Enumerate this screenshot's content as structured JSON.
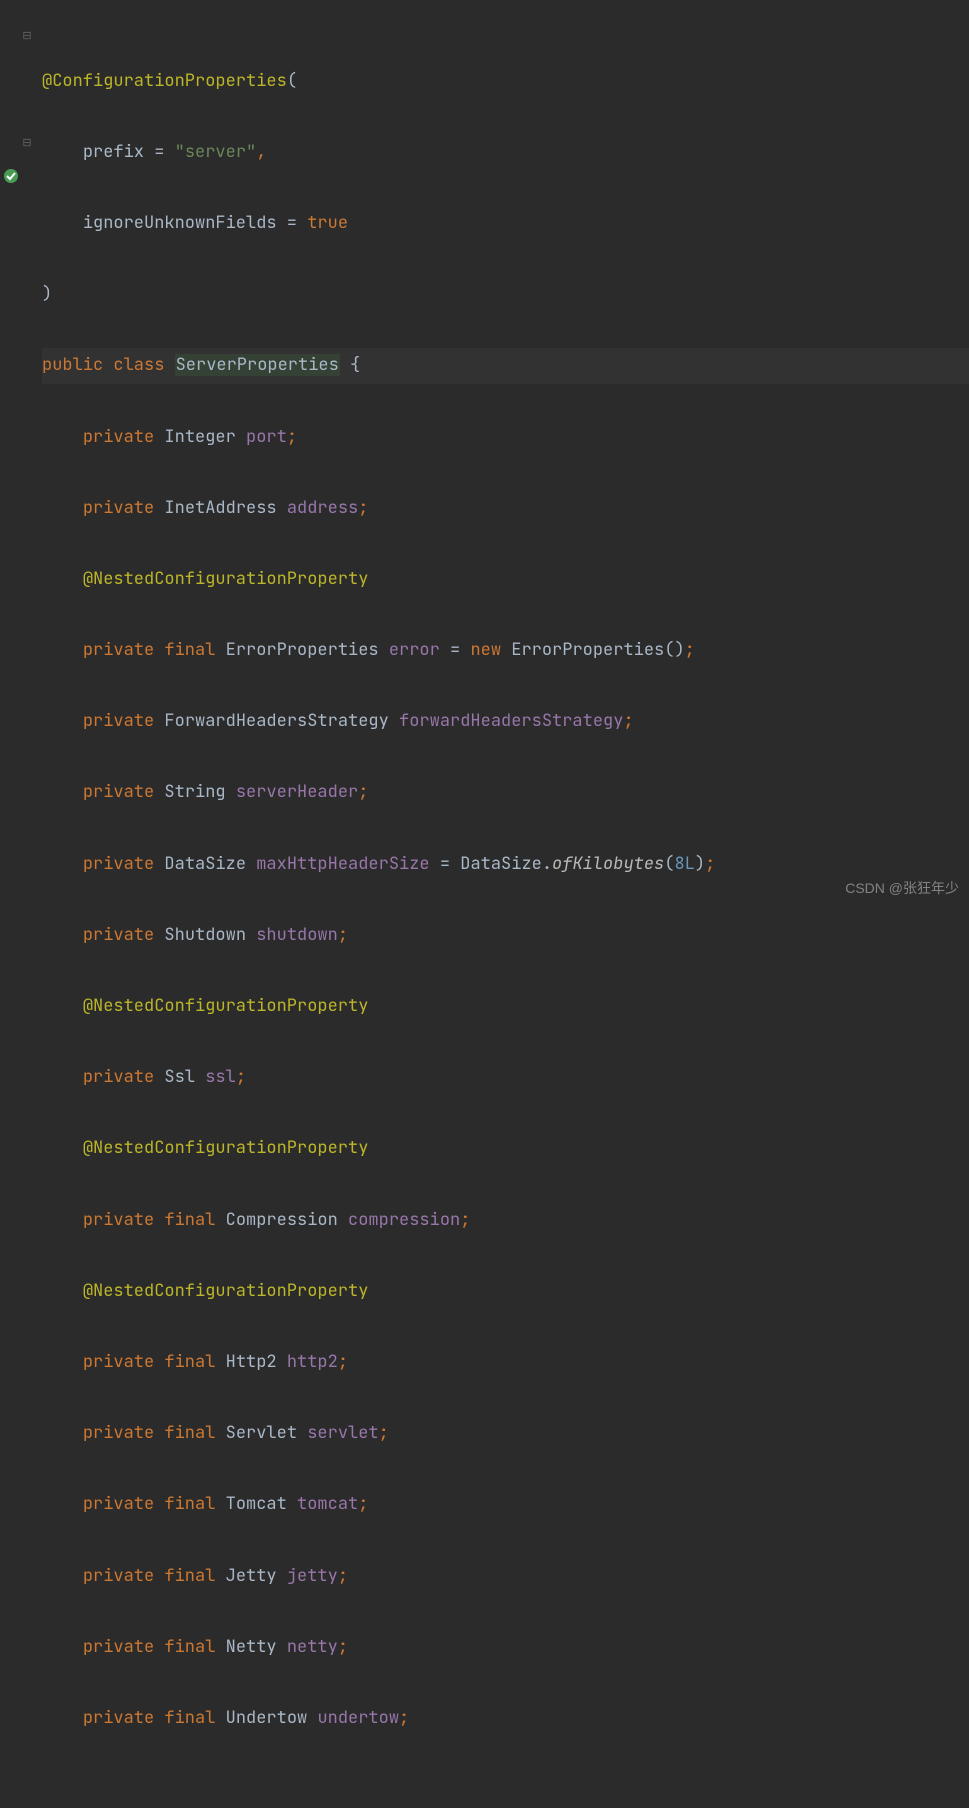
{
  "code": {
    "l1": {
      "anno": "@ConfigurationProperties",
      "paren": "("
    },
    "l2": {
      "t1": "prefix = ",
      "str": "\"server\"",
      "comma": ","
    },
    "l3": {
      "t1": "ignoreUnknownFields = ",
      "kw": "true"
    },
    "l4": {
      "paren": ")"
    },
    "l5": {
      "kw1": "public class ",
      "cls": "ServerProperties",
      "brace": " {"
    },
    "l6": {
      "kw": "private ",
      "type": "Integer ",
      "mem": "port",
      "semi": ";"
    },
    "l7": {
      "kw": "private ",
      "type": "InetAddress ",
      "mem": "address",
      "semi": ";"
    },
    "l8": {
      "anno": "@NestedConfigurationProperty"
    },
    "l9": {
      "kw1": "private final ",
      "type": "ErrorProperties ",
      "mem": "error",
      "eq": " = ",
      "kw2": "new ",
      "ctor": "ErrorProperties()",
      "semi": ";"
    },
    "l10": {
      "kw": "private ",
      "type": "ForwardHeadersStrategy ",
      "mem": "forwardHeadersStrategy",
      "semi": ";"
    },
    "l11": {
      "kw": "private ",
      "type": "String ",
      "mem": "serverHeader",
      "semi": ";"
    },
    "l12": {
      "kw": "private ",
      "type": "DataSize ",
      "mem": "maxHttpHeaderSize",
      "eq": " = DataSize.",
      "stat": "ofKilobytes",
      "po": "(",
      "num": "8L",
      "pc": ")",
      "semi": ";"
    },
    "l13": {
      "kw": "private ",
      "type": "Shutdown ",
      "mem": "shutdown",
      "semi": ";"
    },
    "l14": {
      "anno": "@NestedConfigurationProperty"
    },
    "l15": {
      "kw": "private ",
      "type": "Ssl ",
      "mem": "ssl",
      "semi": ";"
    },
    "l16": {
      "anno": "@NestedConfigurationProperty"
    },
    "l17": {
      "kw1": "private final ",
      "type": "Compression ",
      "mem": "compression",
      "semi": ";"
    },
    "l18": {
      "anno": "@NestedConfigurationProperty"
    },
    "l19": {
      "kw1": "private final ",
      "type": "Http2 ",
      "mem": "http2",
      "semi": ";"
    },
    "l20": {
      "kw1": "private final ",
      "type": "Servlet ",
      "mem": "servlet",
      "semi": ";"
    },
    "l21": {
      "kw1": "private final ",
      "type": "Tomcat ",
      "mem": "tomcat",
      "semi": ";"
    },
    "l22": {
      "kw1": "private final ",
      "type": "Jetty ",
      "mem": "jetty",
      "semi": ";"
    },
    "l23": {
      "kw1": "private final ",
      "type": "Netty ",
      "mem": "netty",
      "semi": ";"
    },
    "l24": {
      "kw1": "private final ",
      "type": "Undertow ",
      "mem": "undertow",
      "semi": ";"
    }
  },
  "watermark": "CSDN @张狂年少"
}
